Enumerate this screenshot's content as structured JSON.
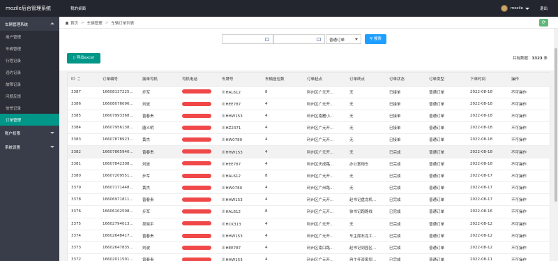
{
  "app": {
    "title": "mozile后台管理系统",
    "top_nav": "我的桌面",
    "user": "mozile",
    "logout": "退出"
  },
  "sidebar": {
    "groups": [
      {
        "label": "车辆管理系统",
        "items": [
          "用户管理",
          "车辆管理",
          "行程记录",
          "违约记录",
          "故障记录",
          "问题反馈",
          "信誉记录",
          "订单管理"
        ]
      },
      {
        "label": "账户权限",
        "items": []
      },
      {
        "label": "系统设置",
        "items": []
      }
    ],
    "active": "订单管理"
  },
  "breadcrumb": {
    "items": [
      "首页",
      "车辆管理",
      "车辆订单列表"
    ],
    "separator": ">"
  },
  "search": {
    "date_separator": "-",
    "order_type": "普通订单",
    "search_label": "搜索"
  },
  "toolbar": {
    "export_label": "导出excel",
    "total_prefix": "共有数据：",
    "total_count": "3323",
    "total_suffix": " 条"
  },
  "table": {
    "columns": [
      "ID",
      "订单编号",
      "接单司机",
      "司机电话",
      "车牌号",
      "车辆座位数",
      "订单起点",
      "订单终点",
      "订单状态",
      "订单类型",
      "下单时间",
      "操作"
    ],
    "rows": [
      [
        "3387",
        "16608137225...",
        "步军",
        "",
        "川HAL612",
        "8",
        "利州区广元开...",
        "无",
        "已接单",
        "普通订单",
        "2022-08-18",
        "不可操作"
      ],
      [
        "3386",
        "16608076096...",
        "刘波",
        "",
        "川HEE787",
        "4",
        "利州区广元开...",
        "无",
        "已接单",
        "普通订单",
        "2022-08-18",
        "不可操作"
      ],
      [
        "3385",
        "16607993368...",
        "曾春贵",
        "",
        "川HHW153",
        "4",
        "利州区南雁小...",
        "无",
        "已接单",
        "普通订单",
        "2022-08-18",
        "不可操作"
      ],
      [
        "3384",
        "16607956138...",
        "唐义明",
        "",
        "川HZ2371",
        "4",
        "利州区广元开...",
        "无",
        "已接单",
        "普通订单",
        "2022-08-18",
        "不可操作"
      ],
      [
        "3383",
        "16607878923...",
        "黄杰",
        "",
        "川HW0780",
        "4",
        "利州区广元开...",
        "无",
        "已接单",
        "普通订单",
        "2022-08-18",
        "不可操作"
      ],
      [
        "3382",
        "16607865940...",
        "曾春贵",
        "",
        "川HHW153",
        "4",
        "利州区广元开...",
        "无",
        "已完成",
        "普通订单",
        "2022-08-18",
        "不可操作"
      ],
      [
        "3381",
        "16607842308...",
        "刘波",
        "",
        "川HEE787",
        "4",
        "利州区天成路...",
        "办公室用车",
        "已完成",
        "普通订单",
        "2022-08-18",
        "不可操作"
      ],
      [
        "3380",
        "16607209551...",
        "步军",
        "",
        "川HAL612",
        "8",
        "利州区广元开...",
        "无",
        "已完成",
        "普通订单",
        "2022-08-17",
        "不可操作"
      ],
      [
        "3379",
        "16607171448...",
        "黄杰",
        "",
        "川HW0780",
        "4",
        "利州区广州路...",
        "无",
        "已完成",
        "普通订单",
        "2022-08-17",
        "不可操作"
      ],
      [
        "3378",
        "16606971811...",
        "曾春贵",
        "",
        "川HHW153",
        "4",
        "利州区广元开...",
        "赵书记盘龙机...",
        "已完成",
        "普通订单",
        "2022-08-17",
        "不可操作"
      ],
      [
        "3376",
        "16606102508...",
        "步军",
        "",
        "川HAL612",
        "8",
        "利州区广元开...",
        "徐书记跑路线",
        "已完成",
        "普通订单",
        "2022-08-16",
        "不可操作"
      ],
      [
        "3375",
        "16602794013...",
        "吴晓平",
        "",
        "川HCK313",
        "4",
        "利州区广元开...",
        "无",
        "已完成",
        "普通订单",
        "2022-08-12",
        "不可操作"
      ],
      [
        "3374",
        "16602648417...",
        "曾春贵",
        "",
        "川HHW153",
        "4",
        "利州区广元开...",
        "车主席右龙工...",
        "已完成",
        "普通订单",
        "2022-08-12",
        "不可操作"
      ],
      [
        "3373",
        "16602647835...",
        "刘波",
        "",
        "川HEE787",
        "4",
        "利州区南口路...",
        "赵书记到园区...",
        "已完成",
        "普通订单",
        "2022-08-12",
        "不可操作"
      ],
      [
        "3372",
        "16602011501...",
        "曾春贵",
        "",
        "川HHW153",
        "4",
        "利州区广元开...",
        "冉主任资家坝...",
        "已完成",
        "普通订单",
        "2022-08-11",
        "不可操作"
      ]
    ],
    "highlight_row": 5
  },
  "colors": {
    "topbar": "#23262e",
    "sidebar": "#393d49",
    "active": "#009688",
    "primary": "#1e9fff",
    "redaction": "#f04848"
  }
}
